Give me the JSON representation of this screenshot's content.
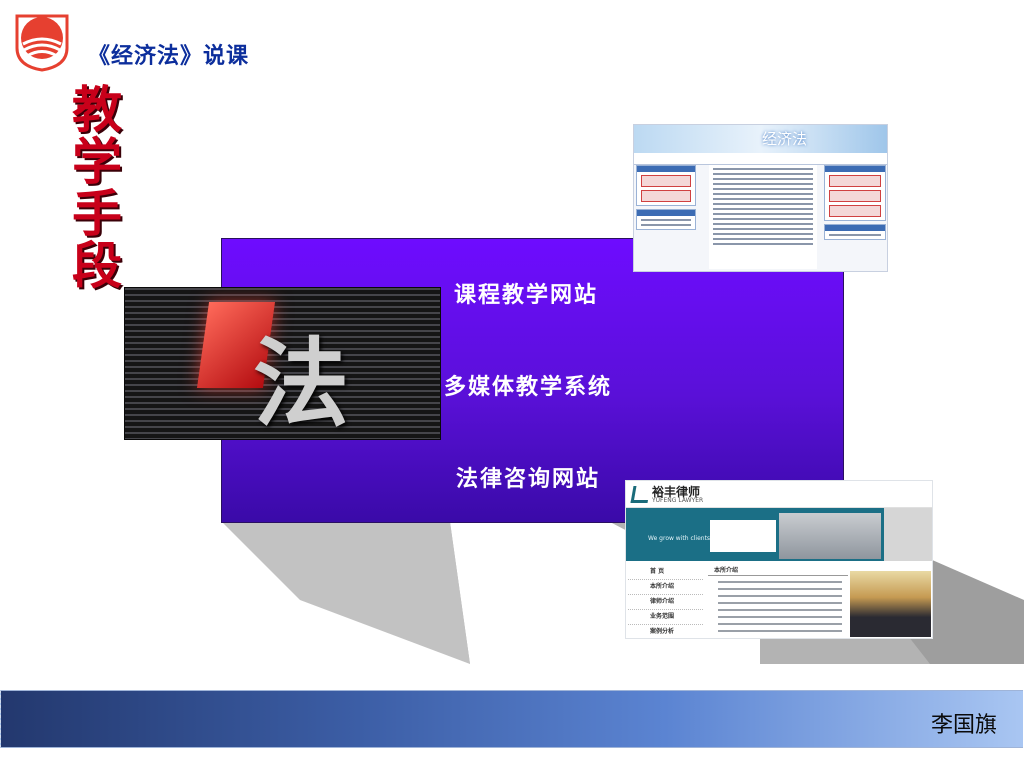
{
  "header": {
    "title": "《经济法》说课"
  },
  "side_heading": [
    "教",
    "学",
    "手",
    "段"
  ],
  "panel": {
    "items": [
      "课程教学网站",
      "多媒体教学系统",
      "法律咨询网站"
    ]
  },
  "video": {
    "glyph": "法"
  },
  "site1": {
    "banner_title": "经济法"
  },
  "site2": {
    "logo_cn": "裕丰律师",
    "logo_en": "YUFENG LAWYER",
    "strip_tag": "We grow with clients",
    "side_items": [
      "首 页",
      "本所介绍",
      "律师介绍",
      "业务范围",
      "案例分析"
    ],
    "section_head": "本所介绍"
  },
  "footer": {
    "author": "李国旗"
  },
  "colors": {
    "title_blue": "#0c2e9c",
    "heading_red": "#c8001a",
    "panel_purple": "#6e0cff",
    "footer_blue": "#3c5ea6"
  }
}
